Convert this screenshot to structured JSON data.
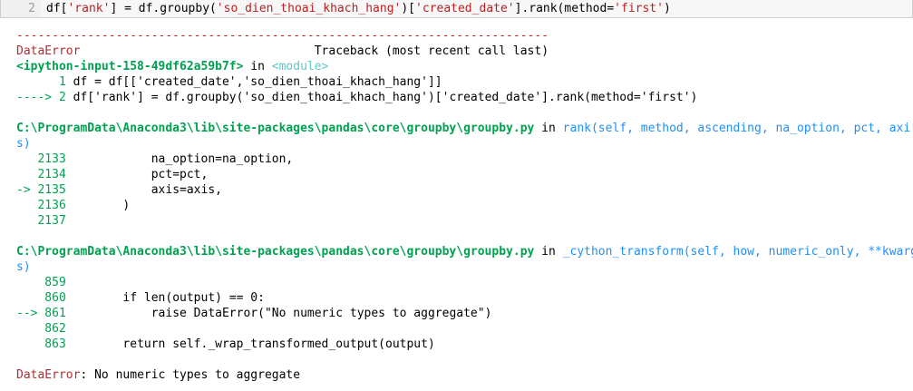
{
  "cell": {
    "line_number": "2",
    "code_prefix": "df[",
    "code_s1": "'rank'",
    "code_mid1": "] = df.groupby(",
    "code_s2": "'so_dien_thoai_khach_hang'",
    "code_mid2": ")[",
    "code_s3": "'created_date'",
    "code_mid3": "].rank(method=",
    "code_s4": "'first'",
    "code_suffix": ")"
  },
  "traceback": {
    "separator": "---------------------------------------------------------------------------",
    "error_name": "DataError",
    "header_gap": "                                 ",
    "header_label": "Traceback (most recent call last)",
    "input_ref": "<ipython-input-158-49df62a59b7f>",
    "in_word": " in ",
    "module_ref": "<module>",
    "frame1_line1_no": "      1 ",
    "frame1_line1_code": "df = df[['created_date','so_dien_thoai_khach_hang']]",
    "frame1_arrow": "----> 2 ",
    "frame1_line2_code": "df['rank'] = df.groupby('so_dien_thoai_khach_hang')['created_date'].rank(method='first')",
    "file_path": "C:\\ProgramData\\Anaconda3\\lib\\site-packages\\pandas\\core\\groupby\\groupby.py",
    "frame2_func": "rank(self, method, ascending, na_option, pct, axi",
    "frame2_wrap": "s)",
    "frame2_lines": [
      {
        "no": "   2133 ",
        "code": "           na_option=na_option,"
      },
      {
        "no": "   2134 ",
        "code": "           pct=pct,"
      },
      {
        "no": "-> 2135 ",
        "code": "           axis=axis,"
      },
      {
        "no": "   2136 ",
        "code": "       )"
      },
      {
        "no": "   2137 ",
        "code": ""
      }
    ],
    "frame3_func": "_cython_transform(self, how, numeric_only, **kwarg",
    "frame3_wrap": "s)",
    "frame3_lines": [
      {
        "no": "    859 ",
        "code": ""
      },
      {
        "no": "    860 ",
        "code": "       if len(output) == 0:"
      },
      {
        "no": "--> 861 ",
        "code": "           raise DataError(\"No numeric types to aggregate\")"
      },
      {
        "no": "    862 ",
        "code": ""
      },
      {
        "no": "    863 ",
        "code": "       return self._wrap_transformed_output(output)"
      }
    ],
    "final_error_name": "DataError",
    "final_error_msg": ": No numeric types to aggregate"
  }
}
